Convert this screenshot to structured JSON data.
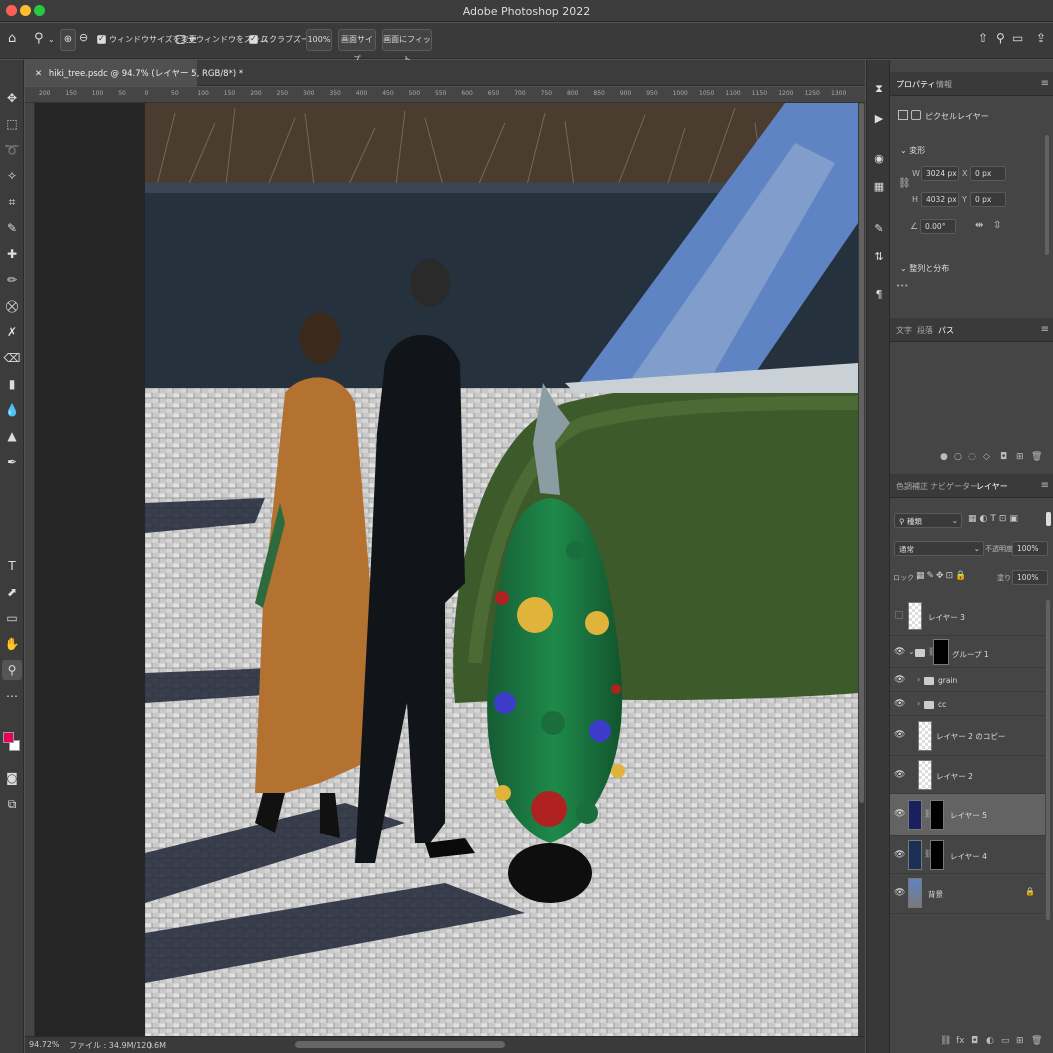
{
  "window": {
    "title": "Adobe Photoshop 2022"
  },
  "options_bar": {
    "resize_windows_label": "ウィンドウサイズを変更",
    "zoom_all_windows_label": "全ウィンドウをズーム",
    "scrubby_zoom_label": "スクラブズーム",
    "zoom_100_label": "100%",
    "fit_screen_label": "画面サイズ",
    "fill_screen_label": "画面にフィット"
  },
  "document": {
    "tab_label": "hiki_tree.psdc @ 94.7% (レイヤー 5, RGB/8*) *",
    "ruler_ticks": [
      "200",
      "150",
      "100",
      "50",
      "0",
      "50",
      "100",
      "150",
      "200",
      "250",
      "300",
      "350",
      "400",
      "450",
      "500",
      "550",
      "600",
      "650",
      "700",
      "750",
      "800",
      "850",
      "900",
      "950",
      "1000",
      "1050",
      "1100",
      "1150",
      "1200",
      "1250",
      "1300"
    ]
  },
  "status": {
    "zoom": "94.72%",
    "file_info": "ファイル : 34.9M/120.6M",
    "arrow": "〉"
  },
  "properties": {
    "tabs": [
      "プロパティ",
      "情報"
    ],
    "layer_type": "ピクセルレイヤー",
    "transform_section": "変形",
    "w_label": "W",
    "w_value": "3024 px",
    "x_label": "X",
    "x_value": "0 px",
    "h_label": "H",
    "h_value": "4032 px",
    "y_label": "Y",
    "y_value": "0 px",
    "angle_value": "0.00°",
    "align_section": "整列と分布",
    "more": "•••"
  },
  "mid_panel": {
    "tabs": [
      "文字",
      "段落",
      "パス"
    ]
  },
  "layers_panel": {
    "tabs": [
      "色調補正",
      "ナビゲーター",
      "レイヤー"
    ],
    "filter_kind": "種類",
    "blend_mode": "通常",
    "opacity_label": "不透明度 :",
    "opacity_value": "100%",
    "lock_label": "ロック :",
    "fill_label": "塗り :",
    "fill_value": "100%",
    "layers": [
      {
        "name": "レイヤー 3"
      },
      {
        "name": "グループ 1"
      },
      {
        "name": "grain"
      },
      {
        "name": "cc"
      },
      {
        "name": "レイヤー 2 のコピー"
      },
      {
        "name": "レイヤー 2"
      },
      {
        "name": "レイヤー 5"
      },
      {
        "name": "レイヤー 4"
      },
      {
        "name": "背景"
      }
    ]
  },
  "colors": {
    "foreground": "#e8005a",
    "background": "#ffffff",
    "selected_layer": "#636363"
  }
}
